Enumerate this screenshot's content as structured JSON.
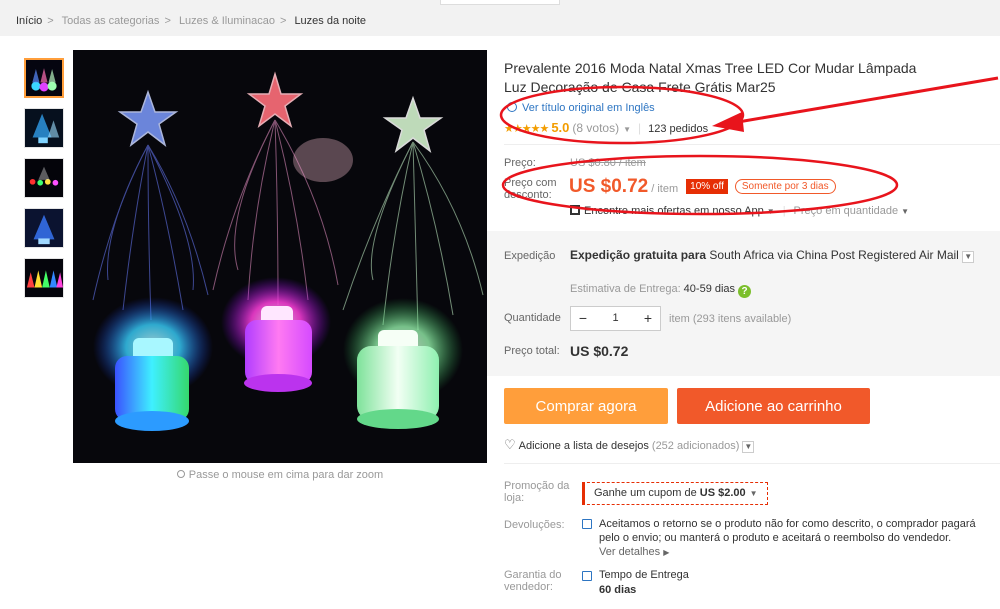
{
  "colors": {
    "accent_orange": "#ff9e3b",
    "cart_orange": "#f1592a",
    "discount_red": "#e62e04",
    "star_gold": "#f39d00",
    "link_blue": "#2d75c2",
    "annotation_red": "#e8141c"
  },
  "breadcrumb": {
    "items": [
      "Início",
      "Todas as categorias",
      "Luzes & Iluminacao",
      "Luzes da noite"
    ],
    "separator": ">"
  },
  "gallery": {
    "thumbnail_count": 5,
    "zoom_hint": "Passe o mouse em cima para dar zoom"
  },
  "product": {
    "title": "Prevalente 2016 Moda Natal Xmas Tree LED Cor Mudar Lâmpada Luz Decoração de Casa Frete Grátis Mar25",
    "original_title_link": "Ver título original em Inglês",
    "rating": {
      "stars": 5,
      "score": "5.0",
      "votes": "(8 votos)",
      "orders": "123 pedidos"
    },
    "price": {
      "label": "Preço:",
      "old": "US $0.80 / item",
      "discount_label": "Preço com desconto:",
      "new": "US $0.72",
      "unit": "/ item",
      "off_badge": "10% off",
      "time_badge": "Somente por 3 dias"
    },
    "app_offer": "Encontre mais ofertas em nosso App",
    "qty_price": "Preço em quantidade"
  },
  "shipping": {
    "label": "Expedição",
    "text": "Expedição gratuita para",
    "destination": "South Africa via China Post Registered Air Mail",
    "estimate_label": "Estimativa de Entrega:",
    "estimate_value": "40-59 dias"
  },
  "quantity": {
    "label": "Quantidade",
    "minus": "−",
    "value": "1",
    "plus": "+",
    "available": "item (293 itens available)"
  },
  "total": {
    "label": "Preço total:",
    "value": "US $0.72"
  },
  "actions": {
    "buy": "Comprar agora",
    "cart": "Adicione ao carrinho",
    "wishlist": "Adicione a lista de desejos",
    "wishlist_count": "(252 adicionados)"
  },
  "store": {
    "promo_label": "Promoção da loja:",
    "coupon_text": "Ganhe um cupom de",
    "coupon_value": "US $2.00",
    "returns_label": "Devoluções:",
    "returns_text": "Aceitamos o retorno se o produto não for como descrito, o comprador pagará pelo o envio; ou manterá o produto e aceitará o reembolso do vendedor.",
    "returns_more": "Ver detalhes",
    "guarantee_label": "Garantia do vendedor:",
    "guarantee_title": "Tempo de Entrega",
    "guarantee_value": "60 dias"
  }
}
